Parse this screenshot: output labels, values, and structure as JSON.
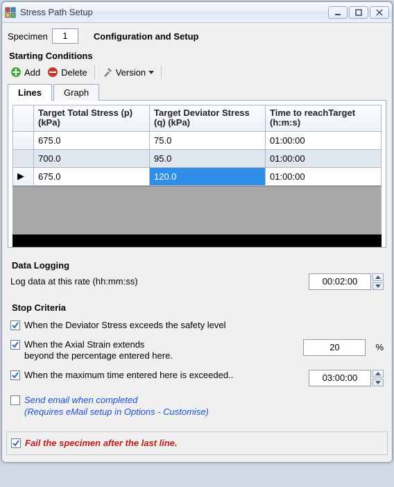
{
  "window": {
    "title": "Stress Path Setup"
  },
  "specimen": {
    "label": "Specimen",
    "value": "1",
    "config_label": "Configuration and Setup"
  },
  "starting": {
    "title": "Starting Conditions",
    "add": "Add",
    "delete": "Delete",
    "version": "Version"
  },
  "tabs": {
    "lines": "Lines",
    "graph": "Graph"
  },
  "grid": {
    "headers": {
      "p": "Target Total Stress (p) (kPa)",
      "q": "Target Deviator Stress (q) (kPa)",
      "t": "Time to reachTarget (h:m:s)"
    },
    "rows": [
      {
        "p": "675.0",
        "q": "75.0",
        "t": "01:00:00"
      },
      {
        "p": "700.0",
        "q": "95.0",
        "t": "01:00:00"
      },
      {
        "p": "675.0",
        "q": "120.0",
        "t": "01:00:00"
      }
    ]
  },
  "datalog": {
    "title": "Data Logging",
    "label": "Log data at this rate (hh:mm:ss)",
    "value": "00:02:00"
  },
  "stop": {
    "title": "Stop Criteria",
    "c1": "When the Deviator Stress exceeds the safety level",
    "c2": "When the Axial Strain extends\nbeyond the percentage entered here.",
    "c2_value": "20",
    "c2_unit": "%",
    "c3": "When the maximum time entered here is exceeded..",
    "c3_value": "03:00:00",
    "email": "Send email when completed\n(Requires eMail setup in Options - Customise)"
  },
  "final": {
    "label": "Fail the specimen after the last line."
  }
}
